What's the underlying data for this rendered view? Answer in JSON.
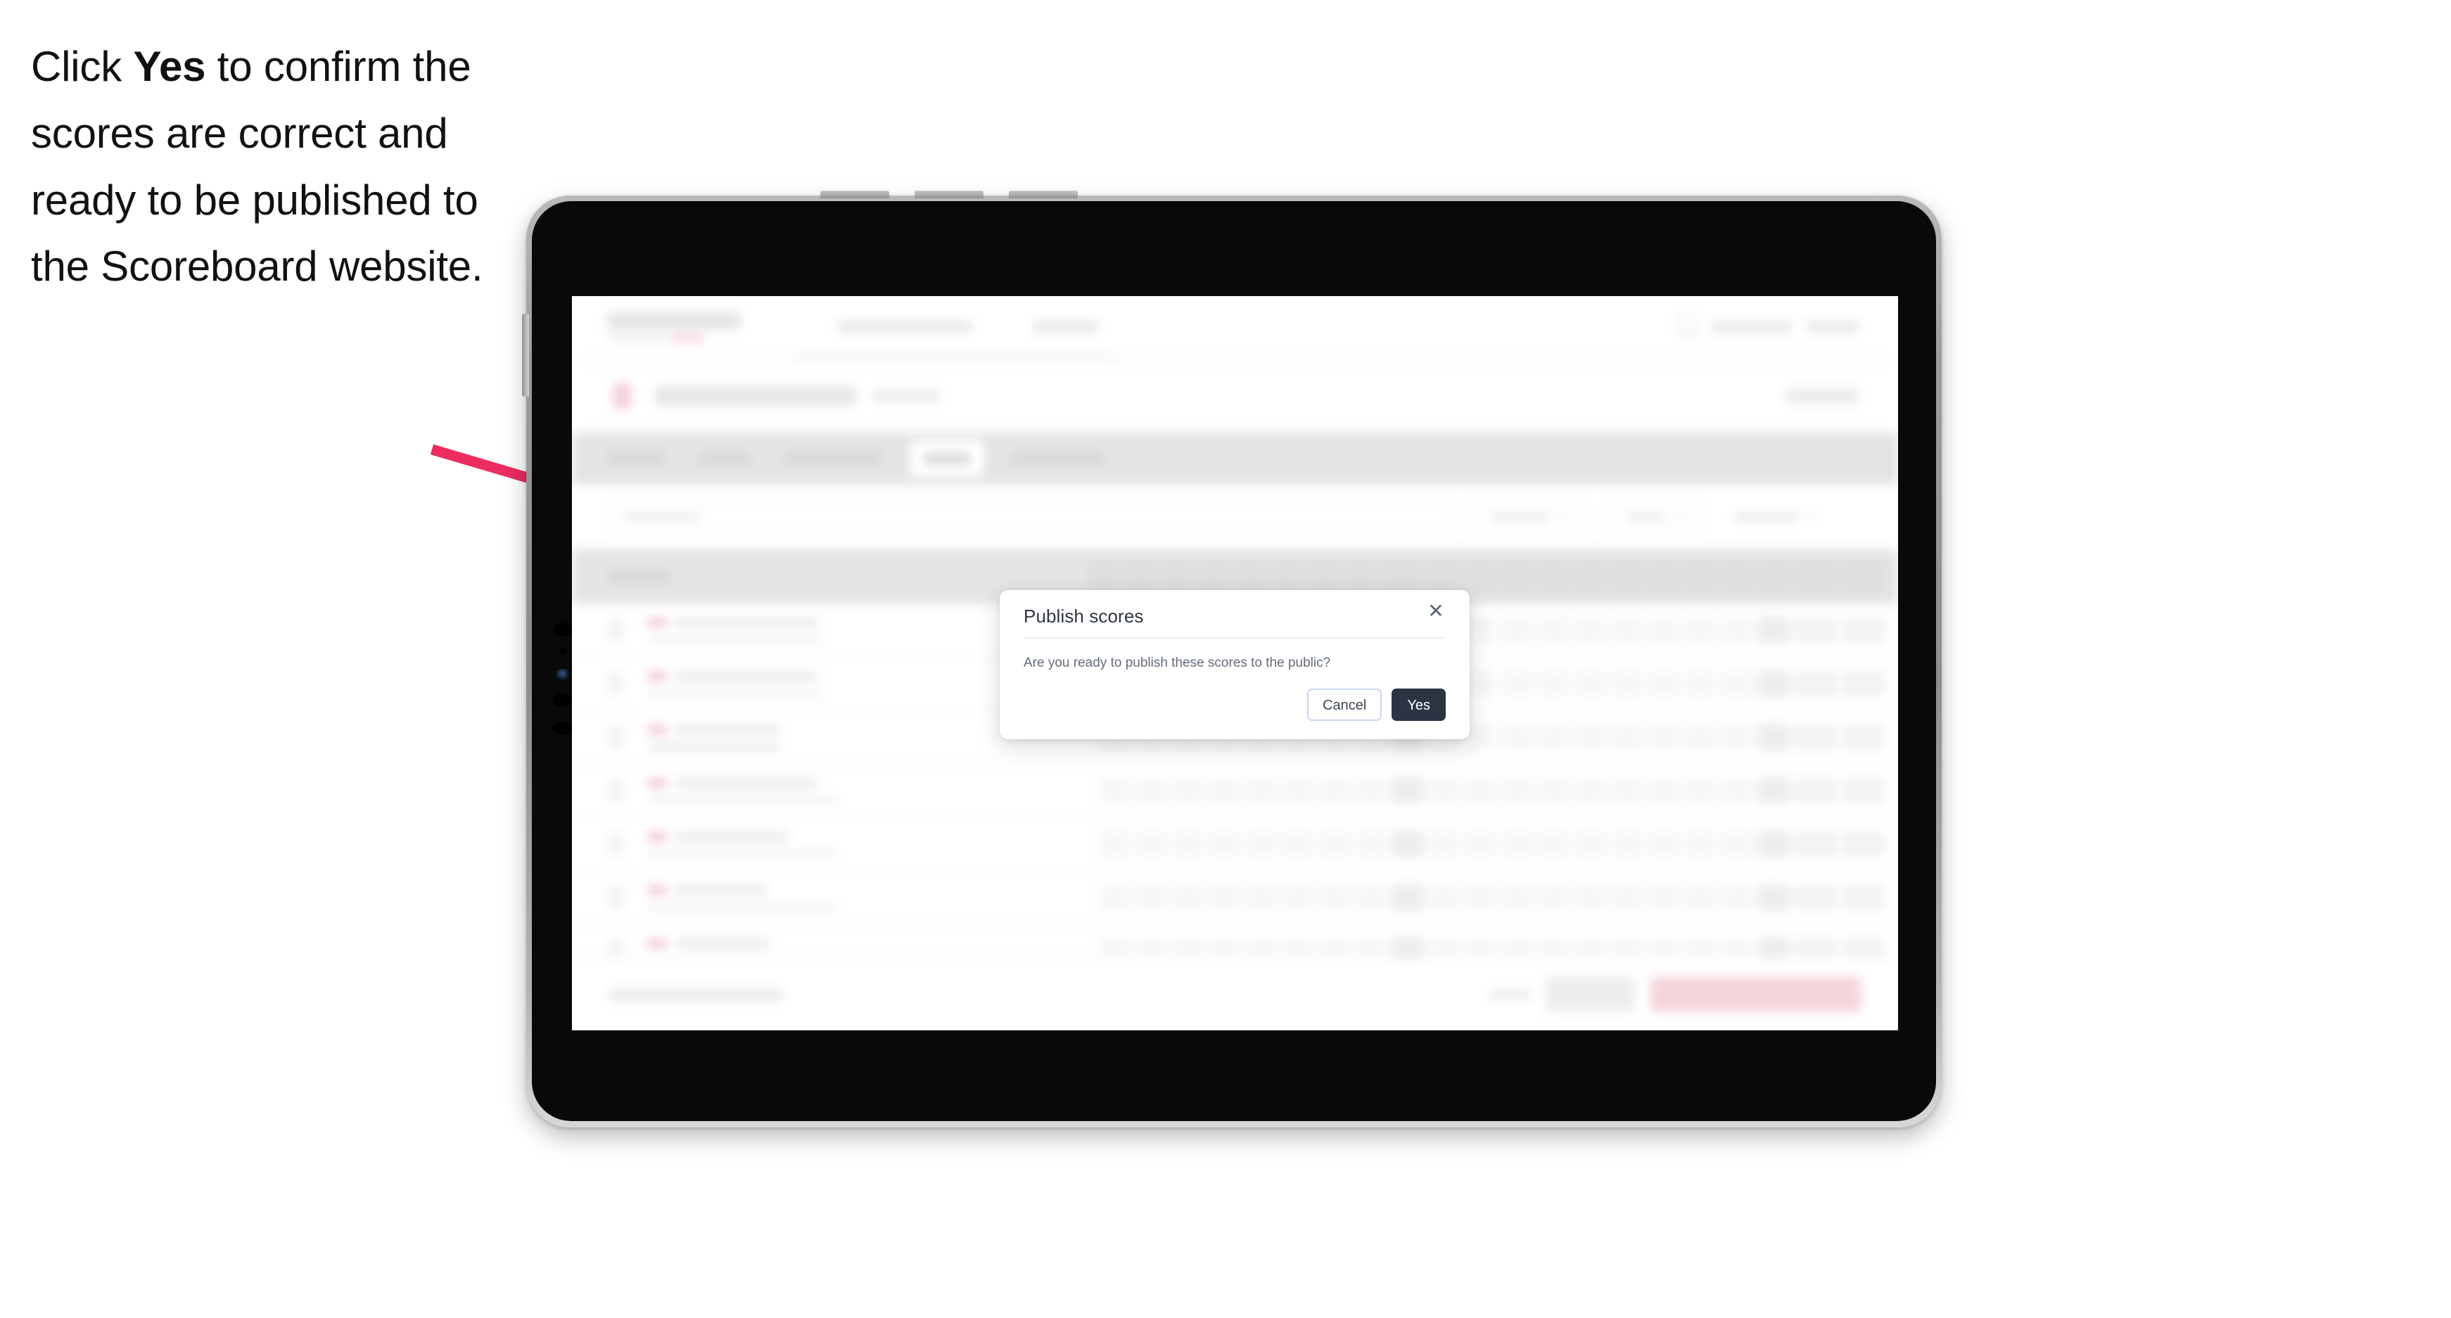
{
  "caption": {
    "before": "Click ",
    "bold": "Yes",
    "after": " to confirm the scores are correct and ready to be published to the Scoreboard website."
  },
  "annotation": {
    "arrow_color": "#ec2d5f",
    "arrow_name": "pointer-arrow"
  },
  "device": {
    "type": "tablet",
    "frame_color": "#9a9b9d",
    "body_color": "#090909"
  },
  "modal": {
    "title": "Publish scores",
    "message": "Are you ready to publish these scores to the public?",
    "close_label": "✕",
    "cancel_label": "Cancel",
    "confirm_label": "Yes",
    "confirm_color": "#2b3443",
    "cancel_border_color": "#c8d6ef"
  }
}
